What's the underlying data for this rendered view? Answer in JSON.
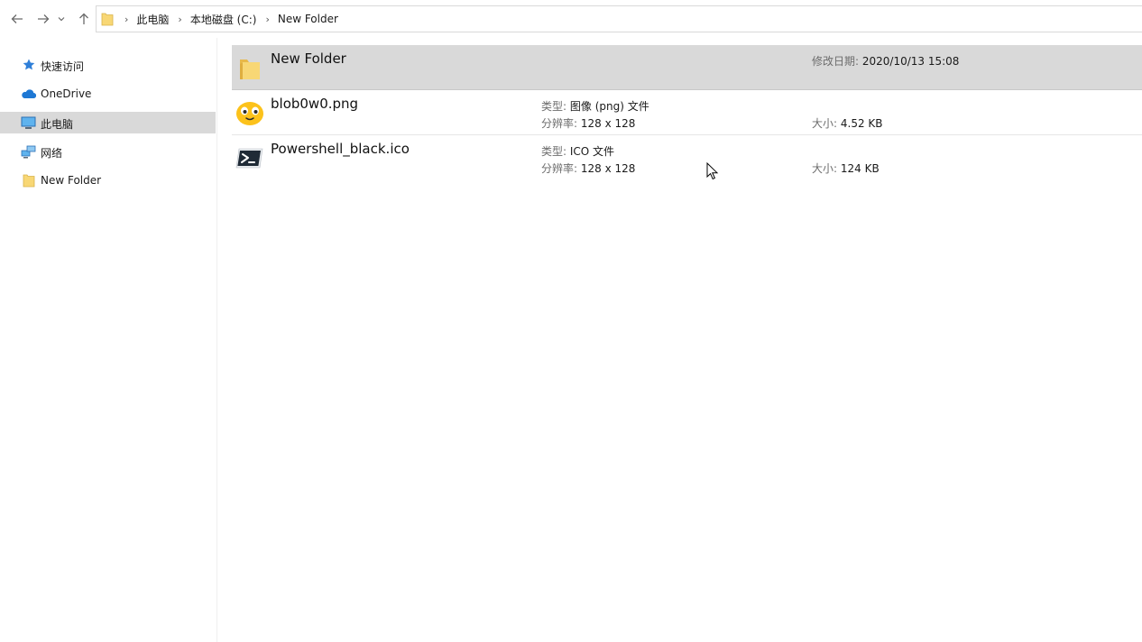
{
  "address_bar": {
    "crumbs": [
      "此电脑",
      "本地磁盘 (C:)",
      "New Folder"
    ]
  },
  "sidebar": {
    "items": [
      {
        "label": "快速访问",
        "icon": "star-icon"
      },
      {
        "label": "OneDrive",
        "icon": "cloud-icon"
      },
      {
        "label": "此电脑",
        "icon": "computer-icon",
        "selected": true
      },
      {
        "label": "网络",
        "icon": "network-icon"
      },
      {
        "label": "New Folder",
        "icon": "folder-icon"
      }
    ]
  },
  "files": [
    {
      "name": "New Folder",
      "icon": "folder-icon",
      "selected": true,
      "date_key": "修改日期:",
      "date_value": "2020/10/13 15:08"
    },
    {
      "name": "blob0w0.png",
      "icon": "blob-emoji-icon",
      "type_key": "类型:",
      "type_value": "图像 (png) 文件",
      "res_key": "分辨率:",
      "res_value": "128 x 128",
      "size_key": "大小:",
      "size_value": "4.52 KB"
    },
    {
      "name": "Powershell_black.ico",
      "icon": "powershell-icon",
      "type_key": "类型:",
      "type_value": "ICO 文件",
      "res_key": "分辨率:",
      "res_value": "128 x 128",
      "size_key": "大小:",
      "size_value": "124 KB"
    }
  ],
  "colors": {
    "selection": "#d9d9d9",
    "folder_yellow": "#f8d775",
    "meta_key": "#6d6d6d"
  }
}
